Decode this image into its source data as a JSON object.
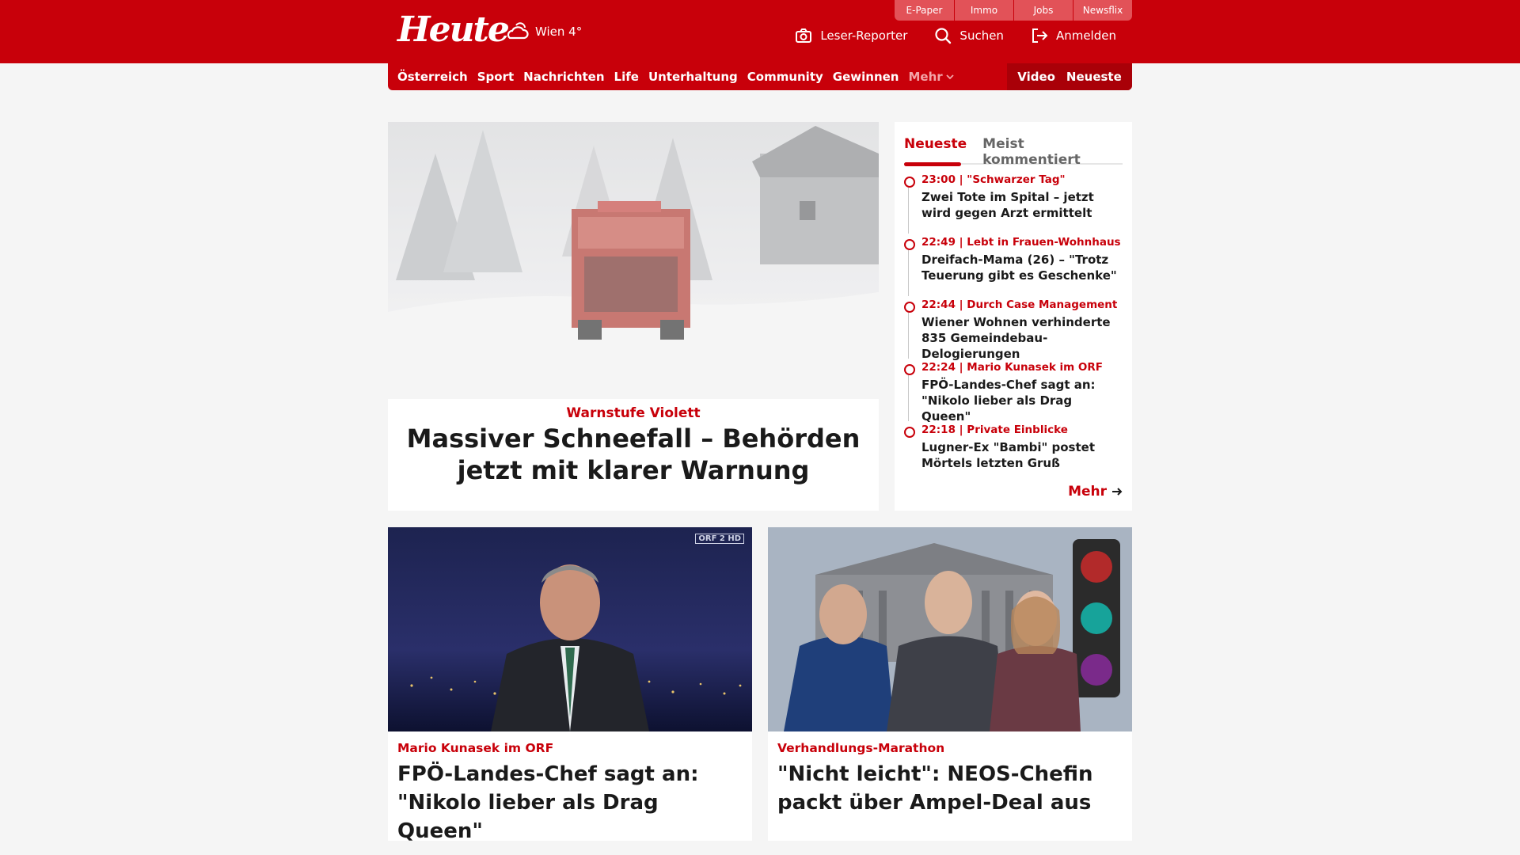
{
  "header": {
    "logo": "Heute",
    "weather": "Wien 4°",
    "service_tabs": [
      "E-Paper",
      "Immo",
      "Jobs",
      "Newsflix"
    ],
    "actions": [
      {
        "label": "Leser-Reporter",
        "icon": "camera-icon"
      },
      {
        "label": "Suchen",
        "icon": "search-icon"
      },
      {
        "label": "Anmelden",
        "icon": "login-icon"
      }
    ]
  },
  "nav": {
    "items": [
      "Österreich",
      "Sport",
      "Nachrichten",
      "Life",
      "Unterhaltung",
      "Community",
      "Gewinnen"
    ],
    "more": "Mehr",
    "video": "Video",
    "latest": "Neueste"
  },
  "hero": {
    "kicker": "Warnstufe Violett",
    "title": "Massiver Schneefall – Behörden jetzt mit klarer Warnung"
  },
  "sidebar": {
    "tabs": [
      "Neueste",
      "Meist kommentiert"
    ],
    "items": [
      {
        "meta": "23:00 | \"Schwarzer Tag\"",
        "title": "Zwei Tote im Spital – jetzt wird gegen Arzt ermittelt"
      },
      {
        "meta": "22:49 | Lebt in Frauen-Wohnhaus",
        "title": "Dreifach-Mama (26) – \"Trotz Teuerung gibt es Geschenke\""
      },
      {
        "meta": "22:44 | Durch Case Management",
        "title": "Wiener Wohnen verhinderte 835 Gemeindebau-Delogierungen"
      },
      {
        "meta": "22:24 | Mario Kunasek im ORF",
        "title": "FPÖ-Landes-Chef sagt an: \"Nikolo lieber als Drag Queen\""
      },
      {
        "meta": "22:18 | Private Einblicke",
        "title": "Lugner-Ex \"Bambi\" postet Mörtels letzten Gruß"
      }
    ],
    "more": "Mehr"
  },
  "cards": [
    {
      "kicker": "Mario Kunasek im ORF",
      "title": "FPÖ-Landes-Chef sagt an: \"Nikolo lieber als Drag Queen\"",
      "badge": "ORF 2 HD"
    },
    {
      "kicker": "Verhandlungs-Marathon",
      "title": "\"Nicht leicht\": NEOS-Chefin packt über Ampel-Deal aus"
    }
  ],
  "colors": {
    "brand": "#c8000a",
    "background": "#f5f5f5"
  }
}
